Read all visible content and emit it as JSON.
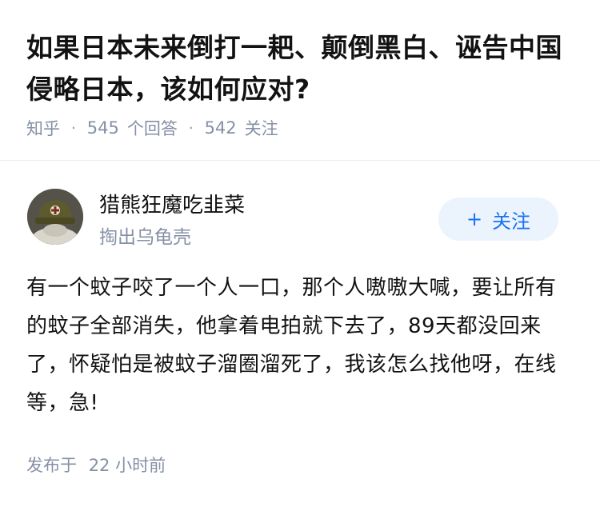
{
  "question": {
    "title": "如果日本未来倒打一耙、颠倒黑白、诬告中国侵略日本，该如何应对?",
    "source": "知乎",
    "answer_count": "545",
    "answer_label": "个回答",
    "follower_count": "542",
    "follower_label": "关注"
  },
  "author": {
    "name": "猎熊狂魔吃韭菜",
    "bio": "掏出乌龟壳",
    "follow_label": "关注",
    "avatar": "avatar-helmet-icon"
  },
  "answer": {
    "content": "有一个蚊子咬了一个人一口，那个人嗷嗷大喊，要让所有的蚊子全部消失，他拿着电拍就下去了，89天都没回来了，怀疑怕是被蚊子溜圈溜死了，我该怎么找他呀，在线等，急!",
    "published_label": "发布于",
    "published_time": "22 小时前"
  },
  "colors": {
    "accent": "#1772f6",
    "follow_bg": "#ebf3fc",
    "meta_text": "#8590a6",
    "main_text": "#121212"
  }
}
